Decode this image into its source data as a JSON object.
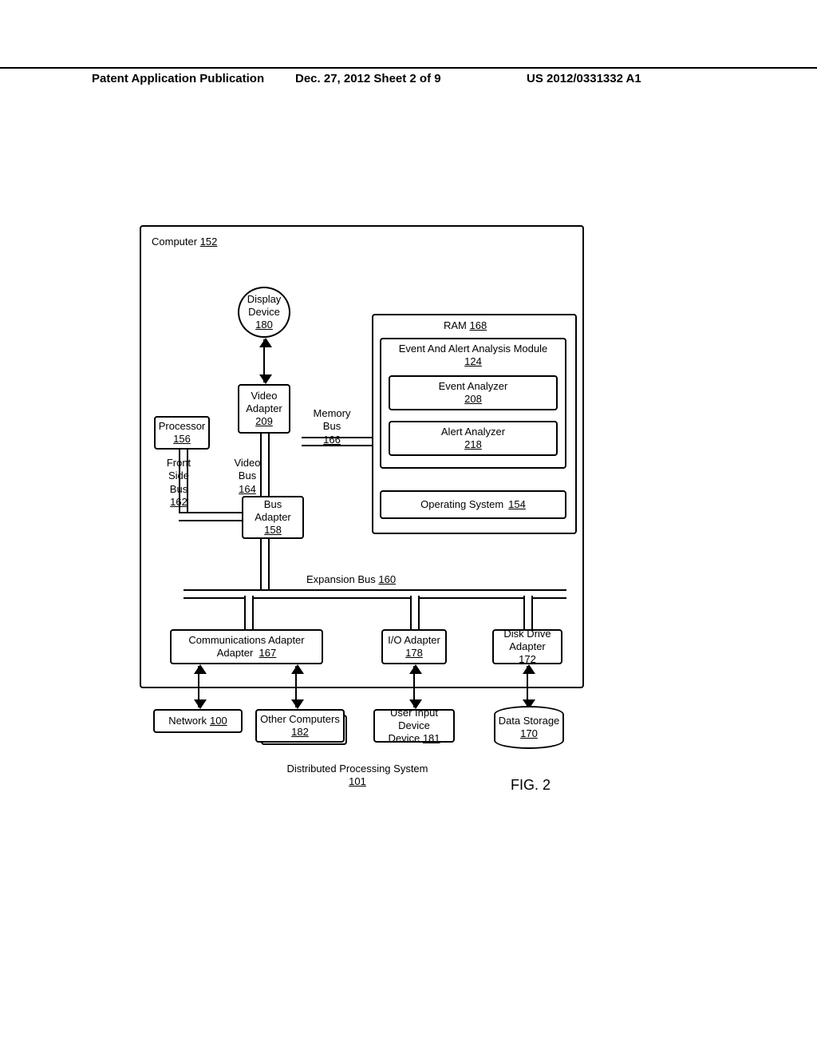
{
  "header": {
    "left": "Patent Application Publication",
    "mid": "Dec. 27, 2012  Sheet 2 of 9",
    "right": "US 2012/0331332 A1"
  },
  "computer": {
    "label": "Computer",
    "ref": "152"
  },
  "display": {
    "label": "Display Device",
    "ref": "180"
  },
  "video_adapter": {
    "label": "Video Adapter",
    "ref": "209"
  },
  "processor": {
    "label": "Processor",
    "ref": "156"
  },
  "bus_adapter": {
    "label": "Bus Adapter",
    "ref": "158"
  },
  "ram": {
    "label": "RAM",
    "ref": "168"
  },
  "eam": {
    "label": "Event And Alert Analysis Module",
    "ref": "124"
  },
  "evt": {
    "label": "Event Analyzer",
    "ref": "208"
  },
  "alt": {
    "label": "Alert Analyzer",
    "ref": "218"
  },
  "os": {
    "label": "Operating System",
    "ref": "154"
  },
  "comm": {
    "label": "Communications Adapter",
    "ref": "167"
  },
  "io": {
    "label": "I/O Adapter",
    "ref": "178"
  },
  "disk": {
    "label": "Disk Drive Adapter",
    "ref": "172"
  },
  "network": {
    "label": "Network",
    "ref": "100"
  },
  "others": {
    "label": "Other Computers",
    "ref": "182"
  },
  "uid": {
    "label": "User Input Device",
    "ref": "181"
  },
  "storage": {
    "label": "Data Storage",
    "ref": "170"
  },
  "fsb": {
    "label": "Front Side Bus",
    "ref": "162"
  },
  "vbus": {
    "label": "Video Bus",
    "ref": "164"
  },
  "mbus": {
    "label": "Memory Bus",
    "ref": "166"
  },
  "ebus": {
    "label": "Expansion Bus",
    "ref": "160"
  },
  "system": {
    "label": "Distributed Processing System",
    "ref": "101"
  },
  "figure": "FIG. 2"
}
